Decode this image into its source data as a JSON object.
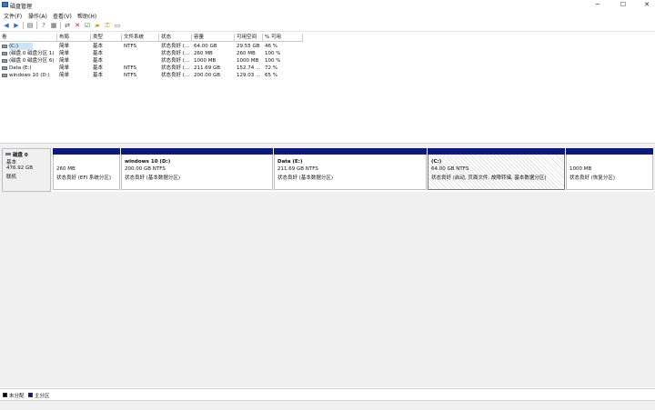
{
  "window": {
    "title": "磁盘管理",
    "btn_min": "─",
    "btn_max": "☐",
    "btn_close": "✕"
  },
  "menu": [
    "文件(F)",
    "操作(A)",
    "查看(V)",
    "帮助(H)"
  ],
  "toolbar": [
    "back-icon",
    "forward-icon",
    "view-icon",
    "help-icon",
    "properties-icon",
    "connect-icon",
    "delete-icon",
    "check-icon",
    "folder-icon",
    "key-icon",
    "console-icon"
  ],
  "volume_table": {
    "columns": [
      "卷",
      "布局",
      "类型",
      "文件系统",
      "状态",
      "容量",
      "可用空间",
      "% 可用"
    ],
    "rows": [
      [
        "(C:)",
        "简单",
        "基本",
        "NTFS",
        "状态良好 (...",
        "64.00 GB",
        "29.55 GB",
        "46 %"
      ],
      [
        "(磁盘 0 磁盘分区 1)",
        "简单",
        "基本",
        "",
        "状态良好 (...",
        "260 MB",
        "260 MB",
        "100 %"
      ],
      [
        "(磁盘 0 磁盘分区 6)",
        "简单",
        "基本",
        "",
        "状态良好 (...",
        "1000 MB",
        "1000 MB",
        "100 %"
      ],
      [
        "Data (E:)",
        "简单",
        "基本",
        "NTFS",
        "状态良好 (...",
        "211.69 GB",
        "152.74 ...",
        "72 %"
      ],
      [
        "windows 10 (D:)",
        "简单",
        "基本",
        "NTFS",
        "状态良好 (...",
        "200.00 GB",
        "129.03 ...",
        "65 %"
      ]
    ]
  },
  "disk": {
    "name": "磁盘 0",
    "type": "基本",
    "size": "476.92 GB",
    "status": "联机",
    "partitions": [
      {
        "name": "",
        "size": "260 MB",
        "status": "状态良好 (EFI 系统分区)"
      },
      {
        "name": "windows 10  (D:)",
        "size": "200.00 GB NTFS",
        "status": "状态良好 (基本数据分区)"
      },
      {
        "name": "Data  (E:)",
        "size": "211.69 GB NTFS",
        "status": "状态良好 (基本数据分区)"
      },
      {
        "name": "(C:)",
        "size": "64.00 GB NTFS",
        "status": "状态良好 (启动, 页面文件, 故障转储, 基本数据分区)"
      },
      {
        "name": "",
        "size": "1000 MB",
        "status": "状态良好 (恢复分区)"
      }
    ]
  },
  "legend": [
    "未分配",
    "主分区"
  ],
  "colors": {
    "primary_partition": "#0d1a7a",
    "unallocated": "#000000",
    "selection": "#cce4f7"
  }
}
